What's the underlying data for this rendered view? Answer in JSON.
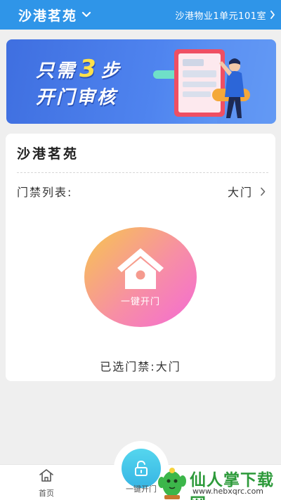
{
  "header": {
    "community_name": "沙港茗苑",
    "room": "沙港物业1单元101室",
    "bg_color": "#2f95e8"
  },
  "banner": {
    "line1_prefix": "只需",
    "line1_number": "3",
    "line1_suffix": "步",
    "line2": "开门审核"
  },
  "card": {
    "title": "沙港茗苑",
    "gate_list_label": "门禁列表:",
    "gate_selected_value": "大门",
    "open_button_label": "一键开门",
    "selected_text": "已选门禁:大门"
  },
  "tabbar": {
    "home_label": "首页",
    "center_label": "一键开门"
  },
  "watermark": {
    "title": "仙人掌下载网",
    "url": "www.hebxqrc.com"
  },
  "icons": [
    "chevron-down-icon",
    "chevron-right-icon",
    "house-icon",
    "home-icon",
    "unlock-icon",
    "cactus-logo"
  ]
}
